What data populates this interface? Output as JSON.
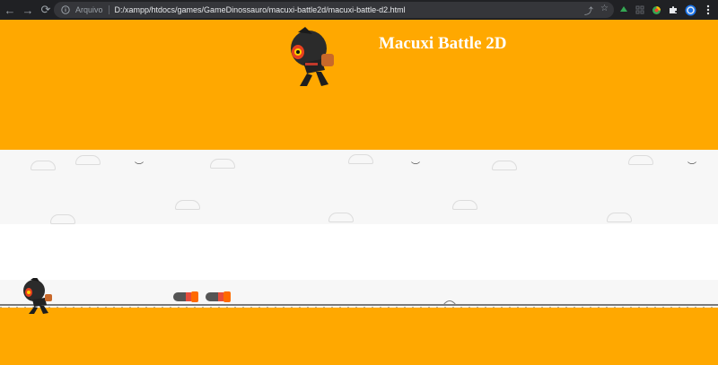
{
  "browser": {
    "scheme_label": "Arquivo",
    "url": "D:/xampp/htdocs/games/GameDinossauro/macuxi-battle2d/macuxi-battle-d2.html",
    "nav": {
      "back": "←",
      "forward": "→",
      "reload": "⟳"
    },
    "actions": {
      "share": "⤴",
      "star": "☆"
    },
    "extensions": [
      "green-arrow",
      "grid",
      "colorful",
      "puzzle",
      "profile",
      "menu"
    ]
  },
  "page": {
    "title": "Macuxi Battle 2D",
    "background_color": "#ffa800"
  },
  "game": {
    "player": "ninja",
    "projectiles": 2,
    "sky_color": "#f7f7f7"
  }
}
